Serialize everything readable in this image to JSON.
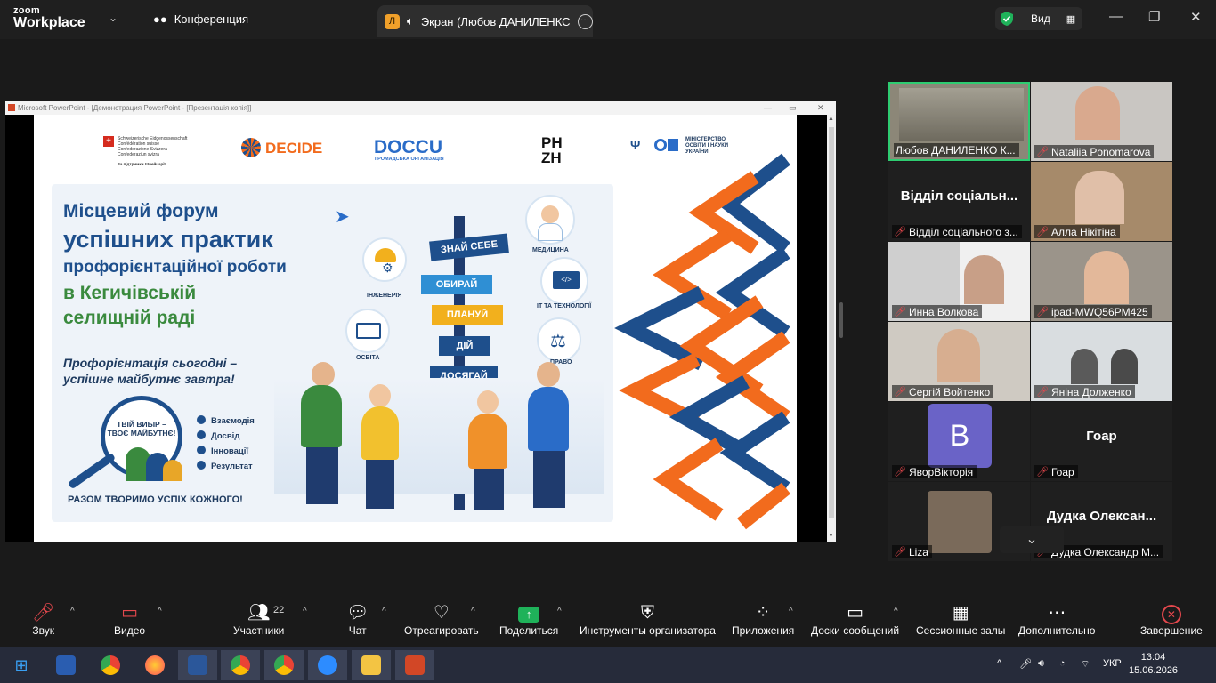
{
  "topbar": {
    "logo_line1": "zoom",
    "logo_line2": "Workplace",
    "conference_label": "Конференция",
    "screen_tab_initial": "Л",
    "screen_tab_label": "Экран (Любов ДАНИЛЕНКС",
    "view_label": "Вид"
  },
  "ppt_window": {
    "title": "Microsoft PowerPoint - [Демонстрация PowerPoint - [Презентація копія]]"
  },
  "slide": {
    "logos": [
      "DECIDE",
      "DOCCU",
      "PH ZH"
    ],
    "swiss_text": "Schweizerische Eidgenossenschaft\nConfédération suisse\nConfederazione Svizzera\nConfederaziun svizra",
    "swiss_support": "За підтримки Швейцарії",
    "docc_sub": "ГРОМАДСЬКА ОРГАНІЗАЦІЯ",
    "ministry": "МІНІСТЕРСТВО ОСВІТИ І НАУКИ УКРАЇНИ",
    "title_line1": "Місцевий форум",
    "title_line2": "успішних практик",
    "title_line3": "профорієнтаційної роботи",
    "title_line4": "в Кегичівській",
    "title_line5": "селищній раді",
    "subtitle1": "Профорієнтація сьогодні –",
    "subtitle2": "успішне майбутнє завтра!",
    "circle_text1": "ТВІЙ ВИБІР –",
    "circle_text2": "ТВОЄ МАЙБУТНЄ!",
    "checks": [
      "Взаємодія",
      "Досвід",
      "Інновації",
      "Результат"
    ],
    "bottom_text": "РАЗОМ ТВОРИМО УСПІХ КОЖНОГО!",
    "signs": [
      "ЗНАЙ СЕБЕ",
      "ОБИРАЙ",
      "ПЛАНУЙ",
      "ДІЙ",
      "ДОСЯГАЙ"
    ],
    "fields": [
      "МЕДИЦИНА",
      "ІНЖЕНЕРІЯ",
      "ІТ ТА ТЕХНОЛОГІЇ",
      "ОСВІТА",
      "ПРАВО"
    ]
  },
  "gallery": {
    "tiles": [
      {
        "name": "Любов ДАНИЛЕНКО К...",
        "big": ""
      },
      {
        "name": "Nataliia Ponomarova",
        "big": ""
      },
      {
        "name": "Відділ соціального з...",
        "big": "Відділ соціальн..."
      },
      {
        "name": "Алла Нікітіна",
        "big": ""
      },
      {
        "name": "Инна Волкова",
        "big": ""
      },
      {
        "name": "ipad-MWQ56PM425",
        "big": ""
      },
      {
        "name": "Сергій Войтенко",
        "big": ""
      },
      {
        "name": "Яніна Долженко",
        "big": ""
      },
      {
        "name": "ЯворВікторія",
        "big": "",
        "initial": "В"
      },
      {
        "name": "Гоар",
        "big": "Гоар"
      },
      {
        "name": "Liza",
        "big": ""
      },
      {
        "name": "Дудка Олександр М...",
        "big": "Дудка Олексан..."
      }
    ]
  },
  "toolbar": {
    "audio": "Звук",
    "video": "Видео",
    "participants": "Участники",
    "participants_count": "22",
    "chat": "Чат",
    "react": "Отреагировать",
    "share": "Поделиться",
    "host_tools": "Инструменты организатора",
    "apps": "Приложения",
    "whiteboards": "Доски сообщений",
    "breakout": "Сессионные залы",
    "more": "Дополнительно",
    "end": "Завершение"
  },
  "taskbar": {
    "lang": "УКР",
    "time": "13:04",
    "date": "15.06.2026"
  },
  "colors": {
    "accent_green": "#2ecc71",
    "share_green": "#1fb25a",
    "mic_off_red": "#e5484d",
    "poster_blue": "#1e4f8c",
    "poster_green": "#3a8a3e",
    "orange": "#f26b1d"
  }
}
